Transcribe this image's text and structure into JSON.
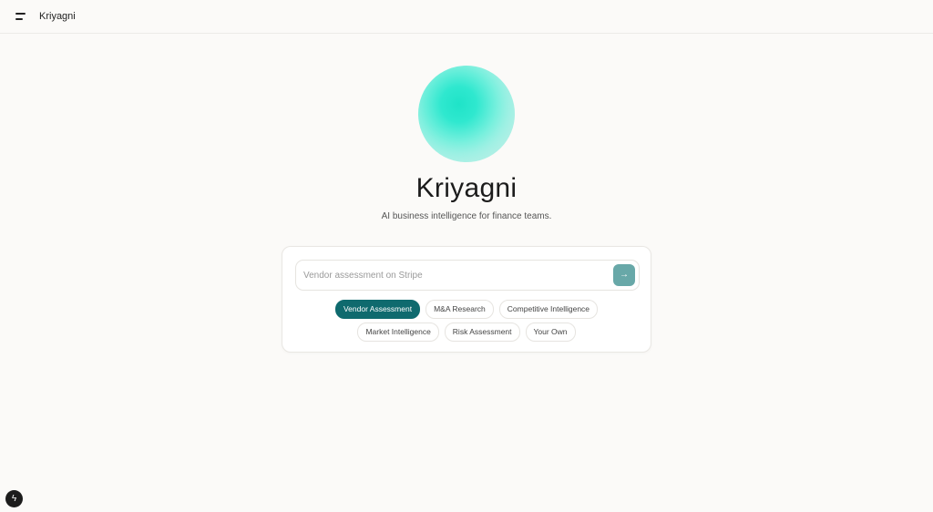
{
  "header": {
    "menu_icon": "menu-icon",
    "app_name": "Kriyagni"
  },
  "hero": {
    "title": "Kriyagni",
    "subtitle": "AI business intelligence for finance teams."
  },
  "search": {
    "placeholder": "Vendor assessment on Stripe",
    "value": "",
    "submit_icon": "arrow-right-icon",
    "submit_glyph": "→"
  },
  "chips": {
    "row1": [
      "Vendor Assessment",
      "M&A Research",
      "Competitive Intelligence"
    ],
    "row2": [
      "Market Intelligence",
      "Risk Assessment",
      "Your Own"
    ],
    "selected": "Vendor Assessment"
  },
  "colors": {
    "accent": "#0f6a6e",
    "submit_button": "#68a8a8",
    "background": "#fbfaf8"
  },
  "corner_button": {
    "icon": "bolt-icon",
    "glyph": "ϟ"
  }
}
